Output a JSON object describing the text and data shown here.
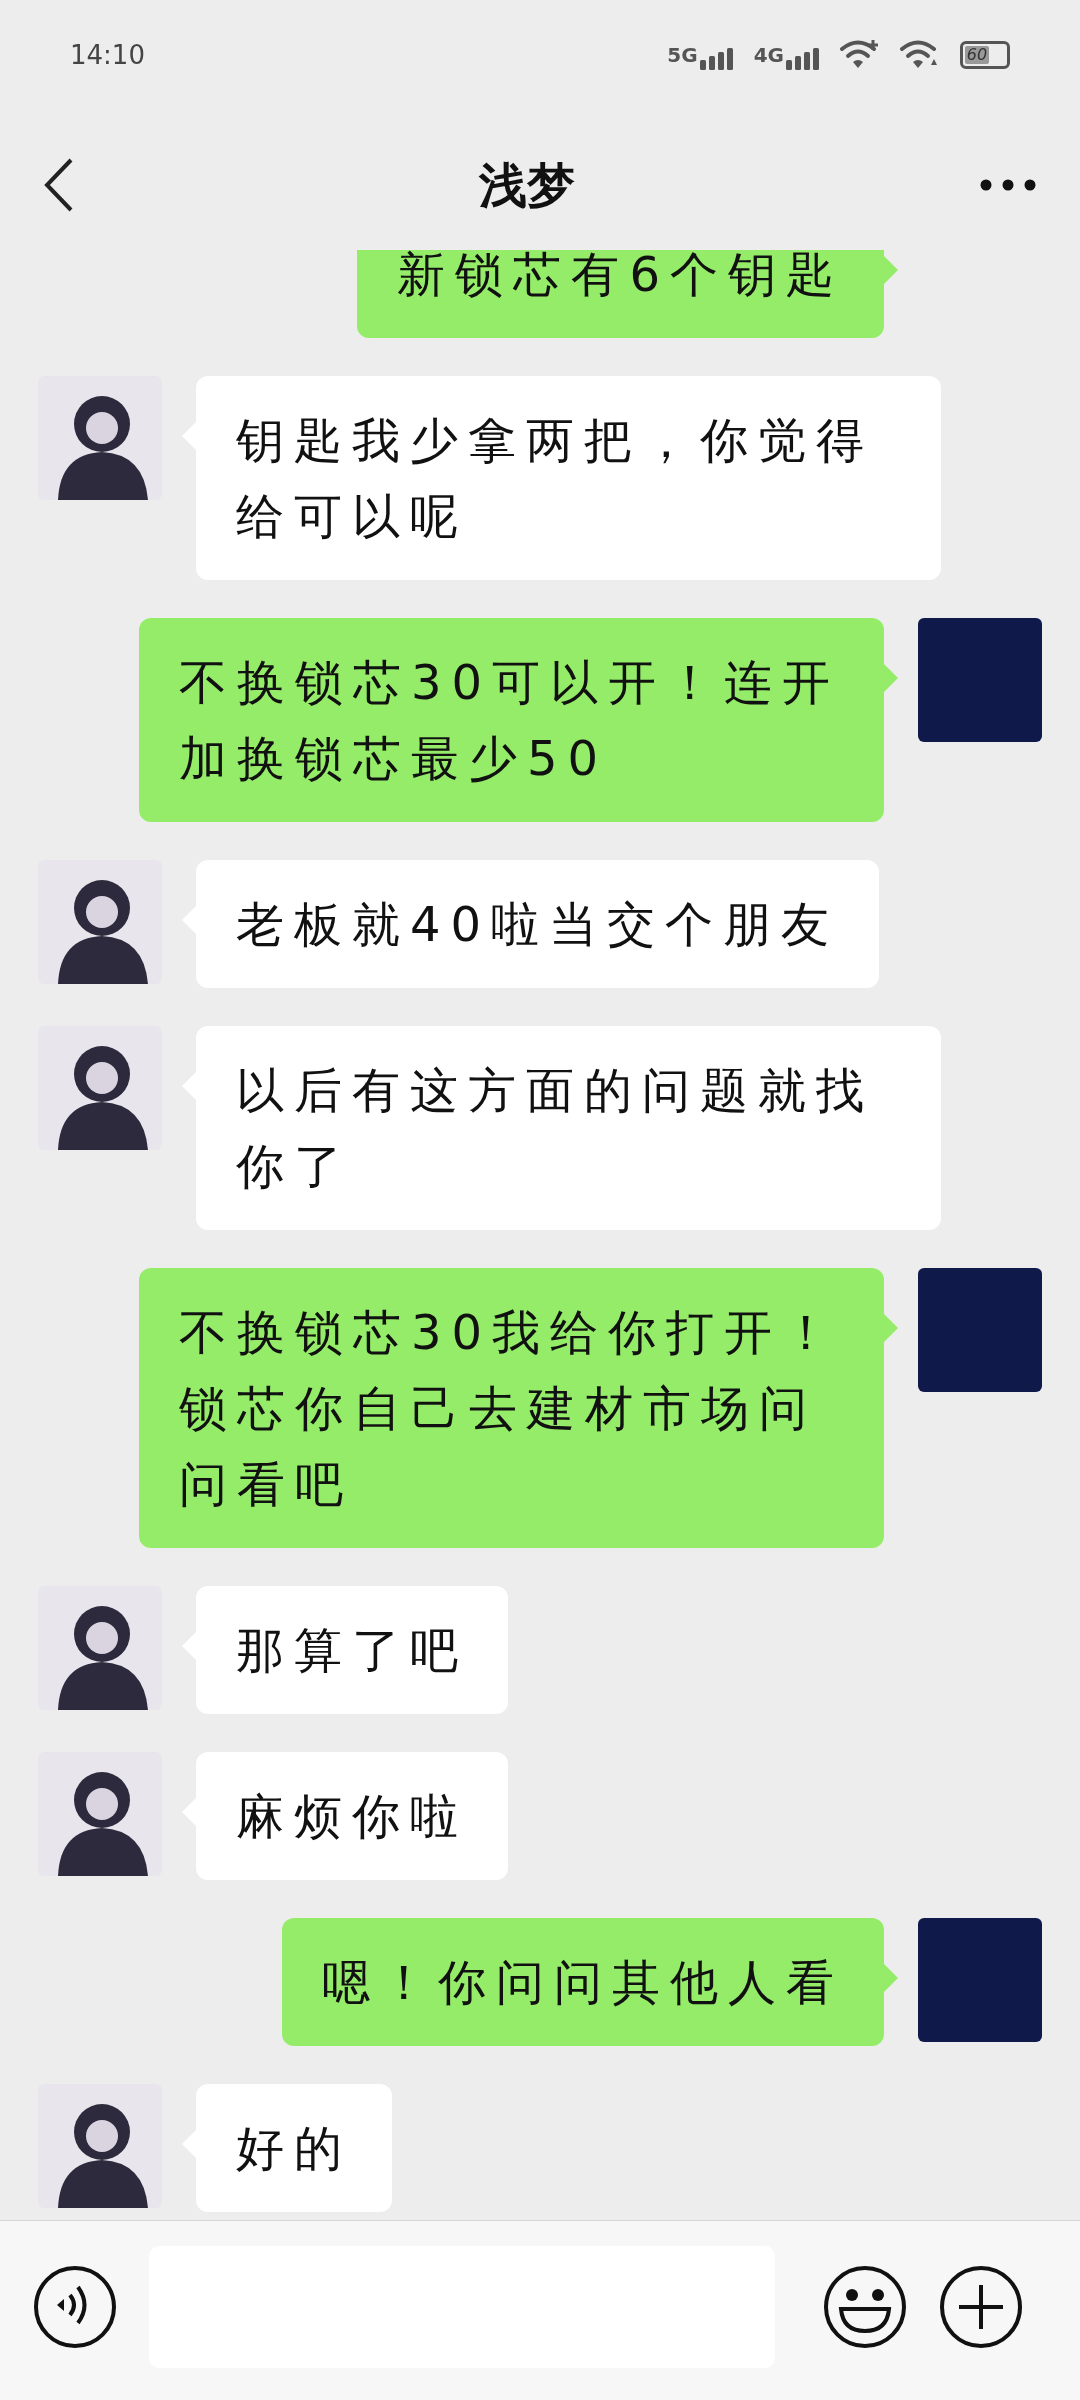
{
  "status_bar": {
    "time": "14:10",
    "networks": [
      {
        "label": "5G"
      },
      {
        "label": "4G"
      }
    ],
    "battery": "60"
  },
  "header": {
    "title": "浅梦"
  },
  "messages": [
    {
      "kind": "outgoing",
      "text": "新锁芯有6个钥匙"
    },
    {
      "kind": "incoming",
      "text": "钥匙我少拿两把，你觉得给可以呢"
    },
    {
      "kind": "outgoing",
      "text": "不换锁芯30可以开！连开加换锁芯最少50"
    },
    {
      "kind": "incoming",
      "text": "老板就40啦当交个朋友"
    },
    {
      "kind": "incoming",
      "text": "以后有这方面的问题就找你了"
    },
    {
      "kind": "outgoing",
      "text": "不换锁芯30我给你打开！锁芯你自己去建材市场问问看吧"
    },
    {
      "kind": "incoming",
      "text": "那算了吧"
    },
    {
      "kind": "incoming",
      "text": "麻烦你啦"
    },
    {
      "kind": "outgoing",
      "text": "嗯！你问问其他人看"
    },
    {
      "kind": "incoming",
      "text": "好的"
    }
  ]
}
